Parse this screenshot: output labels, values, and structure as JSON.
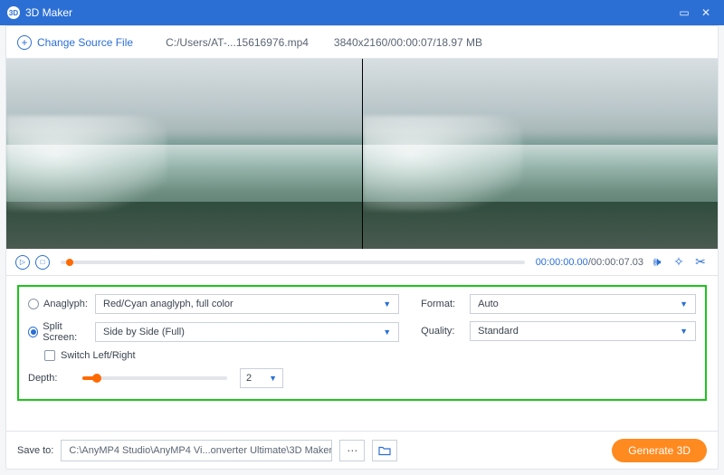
{
  "titlebar": {
    "app_name": "3D Maker"
  },
  "toolbar": {
    "change_label": "Change Source File",
    "file_path": "C:/Users/AT-...15616976.mp4",
    "file_meta": "3840x2160/00:00:07/18.97 MB"
  },
  "player": {
    "time_current": "00:00:00.00",
    "time_total": "00:00:07.03"
  },
  "settings": {
    "anaglyph_label": "Anaglyph:",
    "anaglyph_value": "Red/Cyan anaglyph, full color",
    "split_label": "Split Screen:",
    "split_value": "Side by Side (Full)",
    "switch_label": "Switch Left/Right",
    "depth_label": "Depth:",
    "depth_value": "2",
    "format_label": "Format:",
    "format_value": "Auto",
    "quality_label": "Quality:",
    "quality_value": "Standard"
  },
  "footer": {
    "save_label": "Save to:",
    "save_path": "C:\\AnyMP4 Studio\\AnyMP4 Vi...onverter Ultimate\\3D Maker",
    "generate_label": "Generate 3D"
  }
}
